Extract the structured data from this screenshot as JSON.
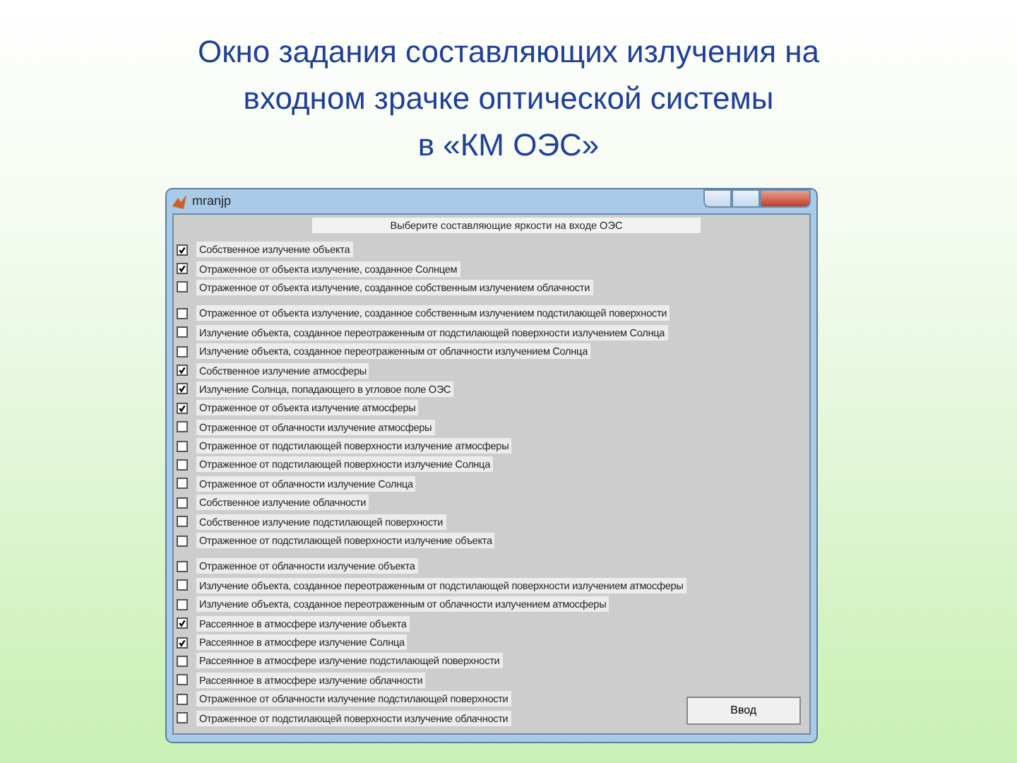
{
  "slide_title": [
    "Окно задания составляющих излучения на",
    "входном зрачке оптической системы",
    "в  «КМ ОЭС»"
  ],
  "window": {
    "title": "mranjp",
    "heading": "Выберите составляющие яркости на входе ОЭС",
    "groups": [
      {
        "items": [
          {
            "label": "Собственное излучение объекта",
            "checked": true
          },
          {
            "label": "Отраженное от объекта излучение, созданное Солнцем",
            "checked": true
          },
          {
            "label": "Отраженное от объекта излучение, созданное собственным излучением облачности",
            "checked": false
          }
        ]
      },
      {
        "items": [
          {
            "label": "Отраженное от объекта излучение, созданное собственным излучением подстилающей поверхности",
            "checked": false
          },
          {
            "label": "Излучение объекта, созданное переотраженным от подстилающей поверхности излучением Солнца",
            "checked": false
          },
          {
            "label": "Излучение объекта, созданное переотраженным от облачности излучением Солнца",
            "checked": false
          },
          {
            "label": "Собственное излучение атмосферы",
            "checked": true
          },
          {
            "label": "Излучение Солнца, попадающего в угловое поле ОЭС",
            "checked": true
          },
          {
            "label": "Отраженное от объекта излучение атмосферы",
            "checked": true
          },
          {
            "label": "Отраженное от облачности излучение атмосферы",
            "checked": false
          },
          {
            "label": "Отраженное от подстилающей поверхности излучение атмосферы",
            "checked": false
          },
          {
            "label": "Отраженное от подстилающей поверхности излучение Солнца",
            "checked": false
          },
          {
            "label": "Отраженное от облачности излучение Солнца",
            "checked": false
          },
          {
            "label": "Собственное излучение облачности",
            "checked": false
          },
          {
            "label": "Собственное излучение подстилающей поверхности",
            "checked": false
          },
          {
            "label": "Отраженное от подстилающей поверхности излучение объекта",
            "checked": false
          }
        ]
      },
      {
        "items": [
          {
            "label": "Отраженное от облачности излучение объекта",
            "checked": false
          },
          {
            "label": "Излучение объекта, созданное переотраженным от подстилающей поверхности излучением атмосферы",
            "checked": false
          },
          {
            "label": "Излучение объекта, созданное переотраженным от облачности излучением атмосферы",
            "checked": false
          },
          {
            "label": "Рассеянное в атмосфере излучение объекта",
            "checked": true
          },
          {
            "label": "Рассеянное в атмосфере излучение Солнца",
            "checked": true
          },
          {
            "label": "Рассеянное в атмосфере излучение подстилающей поверхности",
            "checked": false
          },
          {
            "label": "Рассеянное в атмосфере излучение облачности",
            "checked": false
          },
          {
            "label": "Отраженное от облачности излучение подстилающей поверхности",
            "checked": false
          },
          {
            "label": "Отраженное от подстилающей поверхности излучение облачности",
            "checked": false
          }
        ]
      }
    ],
    "button": "Ввод"
  }
}
